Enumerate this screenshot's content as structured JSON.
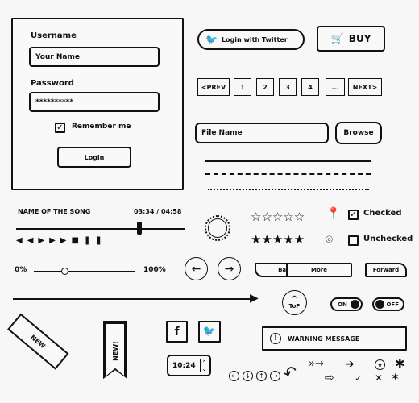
{
  "login": {
    "username_label": "Username",
    "username_value": "Your Name",
    "password_label": "Password",
    "password_value": "**********",
    "remember_label": "Remember me",
    "remember_checked": true,
    "login_button": "Login"
  },
  "social": {
    "twitter_login": "Login with Twitter",
    "buy": "BUY"
  },
  "pagination": {
    "prev": "<PREV",
    "pages": [
      "1",
      "2",
      "3",
      "4",
      "..."
    ],
    "next": "NEXT>"
  },
  "file": {
    "placeholder": "File Name",
    "browse": "Browse"
  },
  "player": {
    "song": "NAME OF THE SONG",
    "time": "03:34 / 04:58",
    "progress": 0.73
  },
  "volume": {
    "min": "0%",
    "max": "100%",
    "value": 0.3
  },
  "rating": {
    "empty_stars": 0,
    "filled_stars": 5
  },
  "checkboxes": [
    {
      "label": "Checked",
      "checked": true
    },
    {
      "label": "Unchecked",
      "checked": false
    }
  ],
  "nav_buttons": {
    "back": "Back",
    "more": "More",
    "forward": "Forward"
  },
  "top_button": "ToP",
  "toggles": {
    "on": "ON",
    "off": "OFF"
  },
  "ribbons": {
    "corner": "NEW",
    "bookmark": "NEW!"
  },
  "warning": "WARNING MESSAGE",
  "time_spinner": "10:24",
  "icons": [
    "facebook-icon",
    "twitter-icon",
    "cart-icon",
    "pin-icon",
    "map-marker-icon",
    "star-icon",
    "check-icon",
    "x-icon",
    "arrow-icon"
  ]
}
